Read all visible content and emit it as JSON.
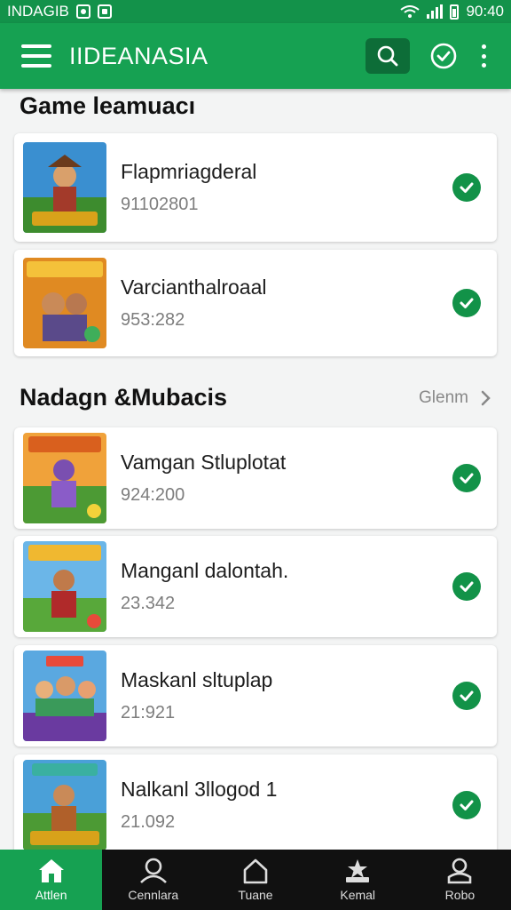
{
  "status_bar": {
    "carrier": "INDAGIB",
    "time": "90:40"
  },
  "app_bar": {
    "title": "IIDEANASIA"
  },
  "sections": [
    {
      "title": "Game  leamuacı",
      "more_label": "",
      "items": [
        {
          "name": "Flapmriagderal",
          "sub": "91102801"
        },
        {
          "name": "Varcianthalroaal",
          "sub": "953:282"
        }
      ]
    },
    {
      "title": "Nadagn &Mubacis",
      "more_label": "Glenm",
      "items": [
        {
          "name": "Vamgan Stluplotat",
          "sub": "924:200"
        },
        {
          "name": "Manganl dalontah.",
          "sub": "23.342"
        },
        {
          "name": "Maskanl sltuplap",
          "sub": "21:921"
        },
        {
          "name": "Nalkanl 3llogod   1",
          "sub": "21.092"
        }
      ]
    }
  ],
  "bottom_nav": [
    {
      "label": "Attlen",
      "icon": "home-icon",
      "active": true
    },
    {
      "label": "Cennlara",
      "icon": "person-icon",
      "active": false
    },
    {
      "label": "Tuane",
      "icon": "house-outline-icon",
      "active": false
    },
    {
      "label": "Kemal",
      "icon": "star-inbox-icon",
      "active": false
    },
    {
      "label": "Robo",
      "icon": "profile-icon",
      "active": false
    }
  ],
  "colors": {
    "primary": "#16a152",
    "primary_dark": "#0d6d38",
    "check": "#129248",
    "nav_bg": "#111111"
  }
}
